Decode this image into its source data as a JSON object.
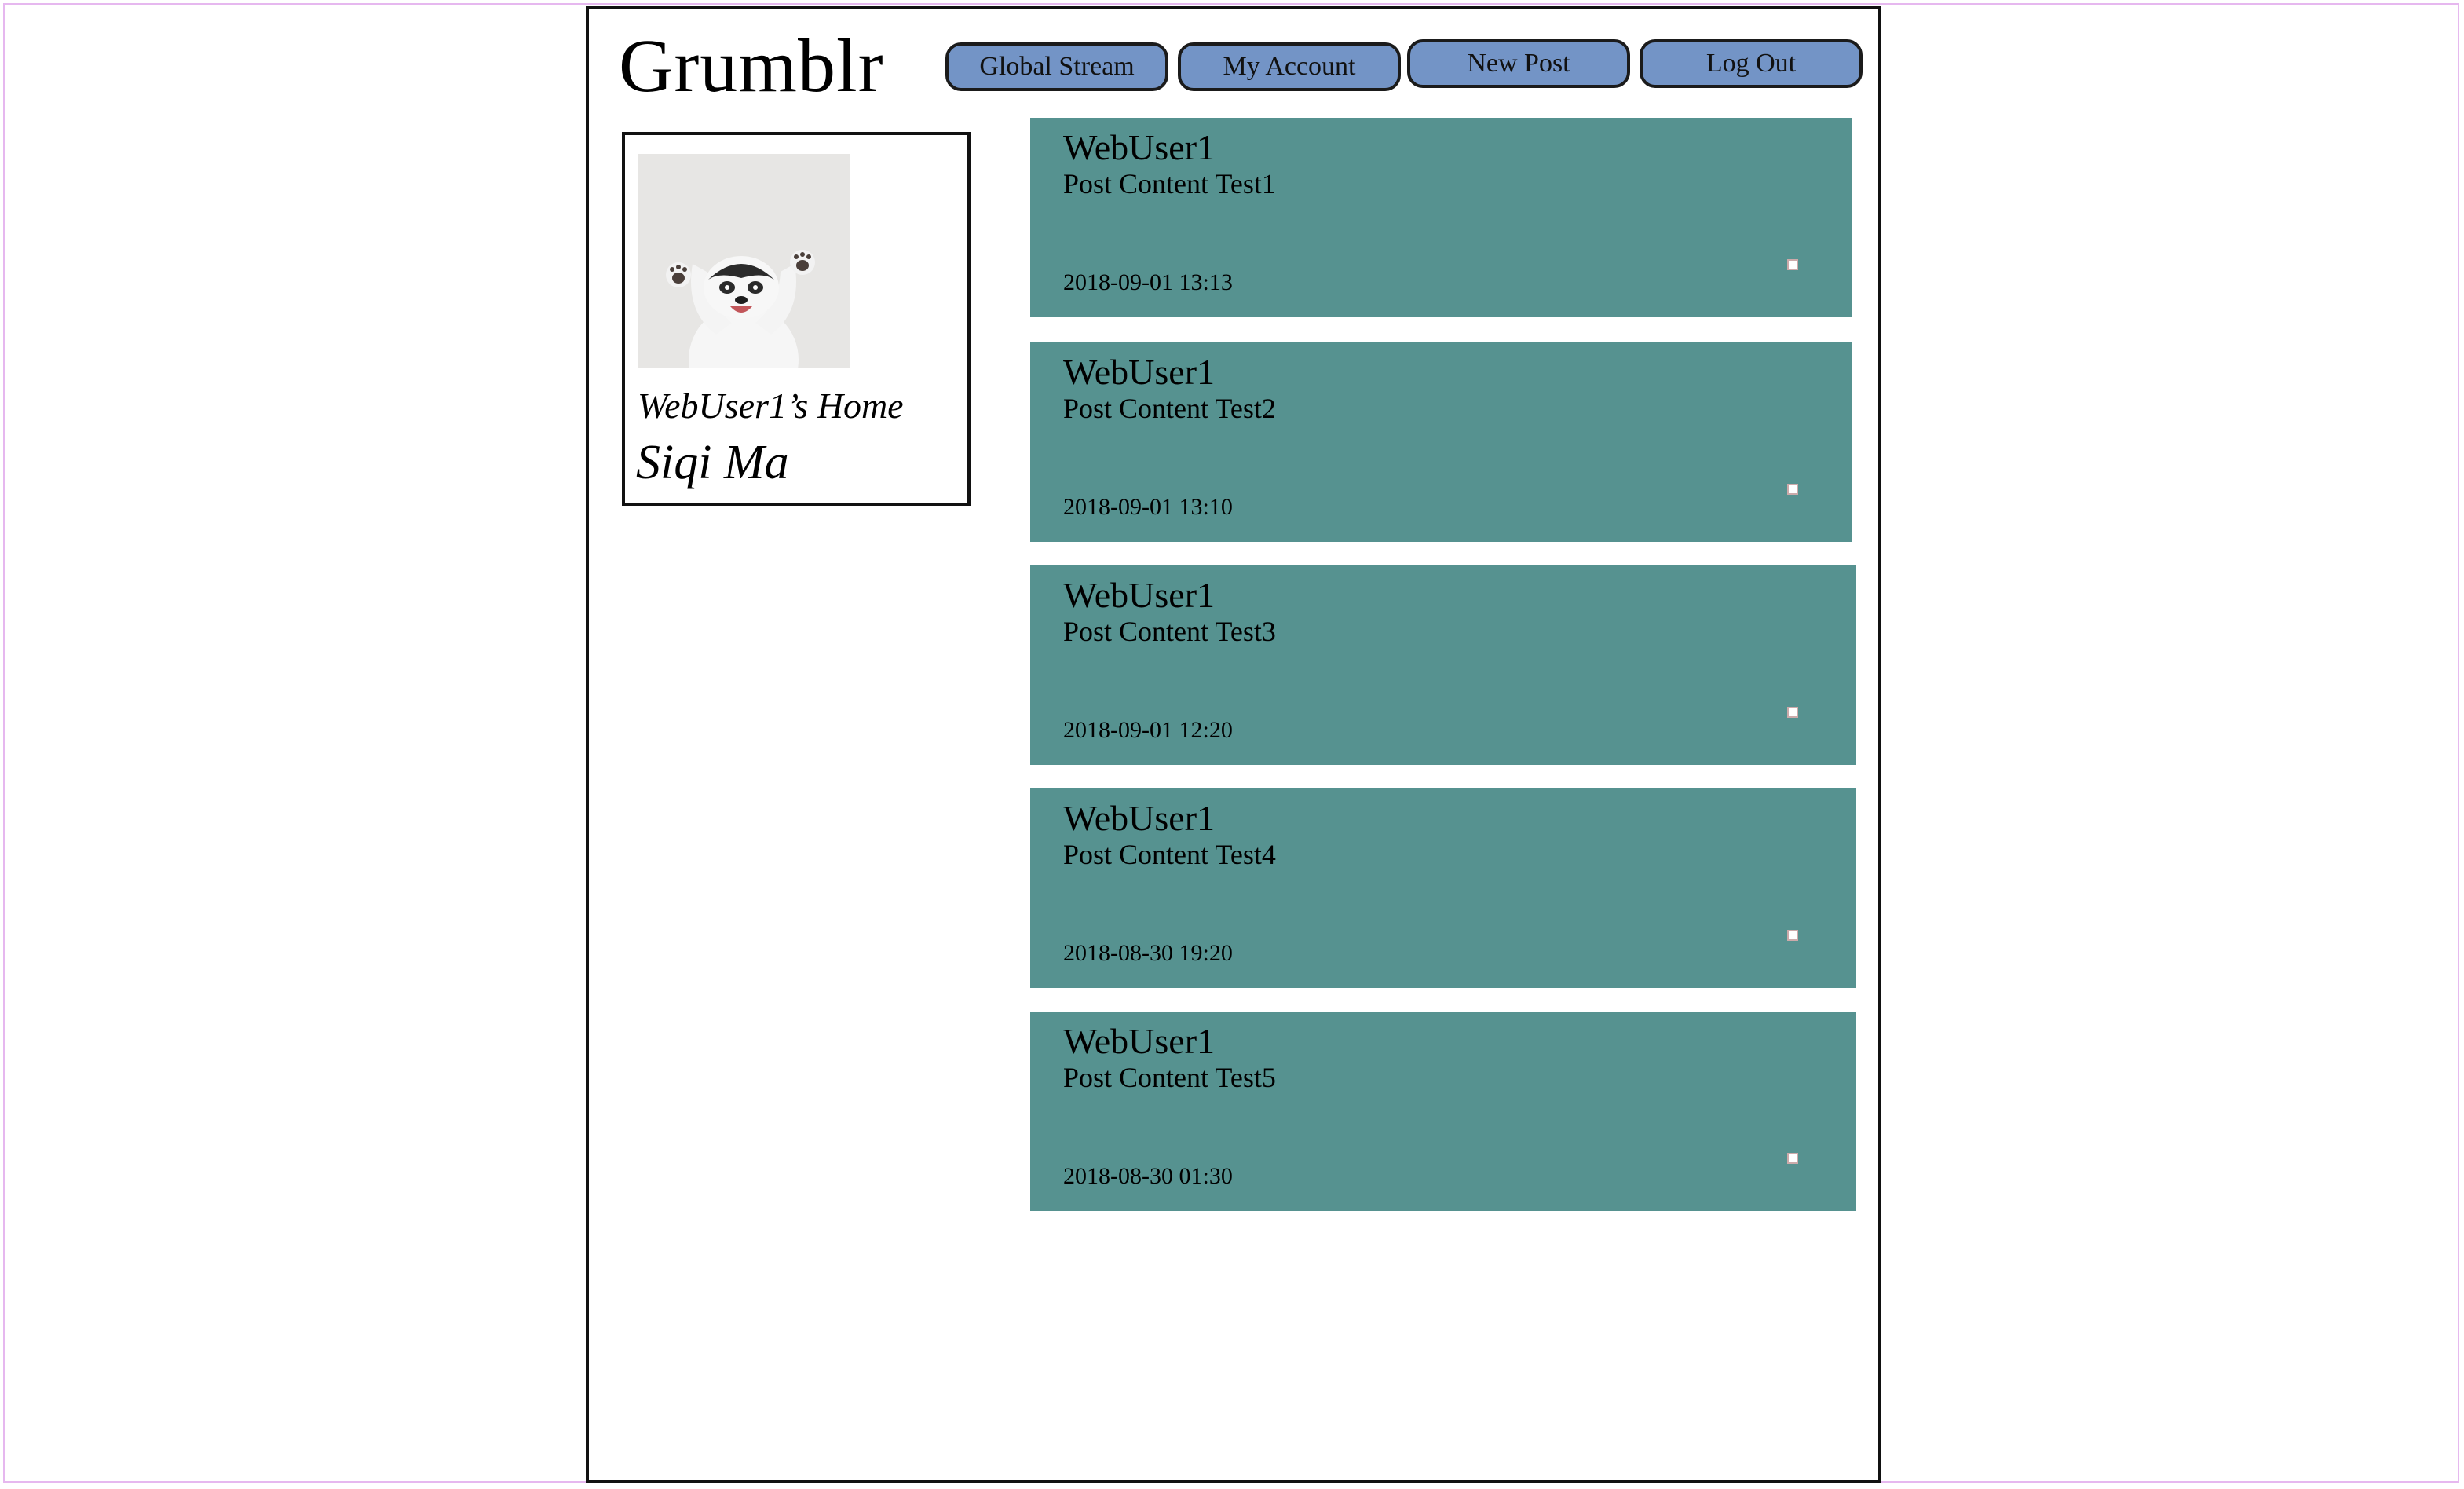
{
  "app": {
    "logo": "Grumblr"
  },
  "nav": {
    "global_stream": "Global Stream",
    "my_account": "My Account",
    "new_post": "New Post",
    "log_out": "Log Out"
  },
  "profile": {
    "home_label": "WebUser1’s Home",
    "full_name": "Siqi Ma"
  },
  "posts": [
    {
      "author": "WebUser1",
      "content": "Post Content Test1",
      "time": "2018-09-01 13:13"
    },
    {
      "author": "WebUser1",
      "content": "Post Content Test2",
      "time": "2018-09-01 13:10"
    },
    {
      "author": "WebUser1",
      "content": "Post Content Test3",
      "time": "2018-09-01 12:20"
    },
    {
      "author": "WebUser1",
      "content": "Post Content Test4",
      "time": "2018-08-30 19:20"
    },
    {
      "author": "WebUser1",
      "content": "Post Content Test5",
      "time": "2018-08-30 01:30"
    }
  ],
  "colors": {
    "nav_button": "#7394c6",
    "post_background": "#569290"
  }
}
